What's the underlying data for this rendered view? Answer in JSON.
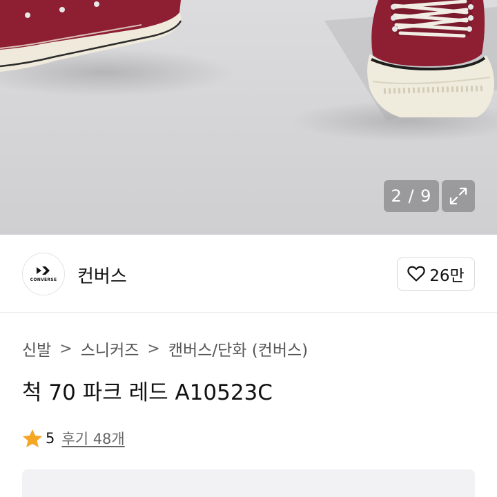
{
  "gallery": {
    "counter": "2 / 9",
    "icons": {
      "expand": "expand-icon"
    }
  },
  "brand": {
    "name": "컨버스",
    "logo_text": "CONVERSE",
    "like_count": "26만",
    "icons": {
      "like": "heart-outline-icon"
    }
  },
  "breadcrumb": {
    "items": [
      "신발",
      "스니커즈",
      "캔버스/단화 (컨버스)"
    ],
    "separator": ">"
  },
  "product": {
    "title": "척 70 파크 레드 A10523C"
  },
  "rating": {
    "score": "5",
    "reviews": "후기 48개",
    "star_color": "#f5a623"
  }
}
